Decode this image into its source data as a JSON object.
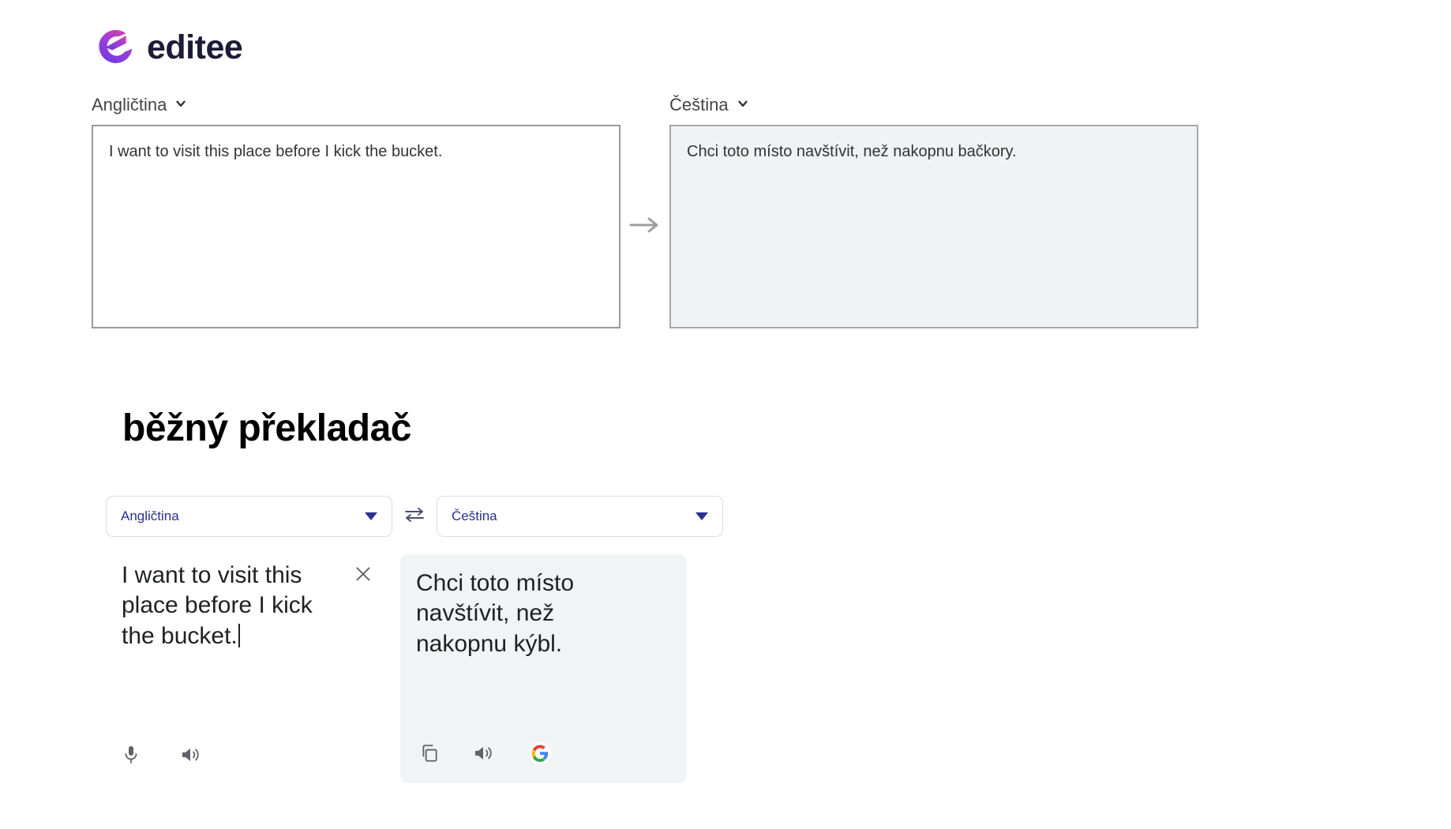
{
  "brand": {
    "name": "editee",
    "logo_icon": "editee-e-logo-icon",
    "gradient_start": "#7b3fe4",
    "gradient_end": "#d946b8"
  },
  "editee_translator": {
    "source": {
      "language_label": "Angličtina",
      "chevron_icon": "chevron-down-icon",
      "text": "I want to visit this place before I kick the bucket."
    },
    "arrow_icon": "arrow-right-icon",
    "target": {
      "language_label": "Čeština",
      "chevron_icon": "chevron-down-icon",
      "text": "Chci toto místo navštívit, než nakopnu bačkory."
    }
  },
  "section": {
    "heading": "běžný překladač"
  },
  "google_translate": {
    "source_language": "Angličtina",
    "target_language": "Čeština",
    "swap_icon": "swap-horizontal-icon",
    "dropdown_icon": "triangle-down-icon",
    "accent_color": "#2b2f8f",
    "source_text": "I want to visit this place before I kick the bucket.",
    "clear_icon": "close-x-icon",
    "microphone_icon": "microphone-icon",
    "source_speaker_icon": "speaker-icon",
    "target_text": "Chci toto místo navštívit, než nakopnu kýbl.",
    "copy_icon": "copy-icon",
    "target_speaker_icon": "speaker-icon",
    "google_icon": "google-g-icon"
  }
}
